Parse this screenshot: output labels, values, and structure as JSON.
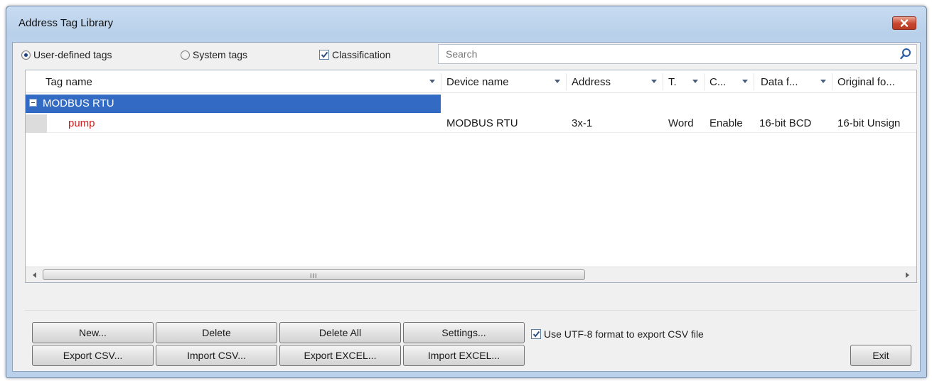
{
  "window": {
    "title": "Address Tag Library"
  },
  "options": {
    "user_defined_label": "User-defined tags",
    "system_tags_label": "System tags",
    "classification_label": "Classification",
    "user_defined_selected": true,
    "classification_checked": true
  },
  "search": {
    "placeholder": "Search"
  },
  "grid": {
    "columns": [
      "Tag name",
      "Device name",
      "Address",
      "T.",
      "C...",
      "Data f...",
      "Original fo..."
    ],
    "group": {
      "label": "MODBUS RTU",
      "rows": [
        {
          "tag_name": "pump",
          "device_name": "MODBUS RTU",
          "address": "3x-1",
          "type": "Word",
          "conversion": "Enable",
          "data_format": "16-bit BCD",
          "original_format": "16-bit Unsign"
        }
      ]
    },
    "scroll_grip": "III"
  },
  "buttons": {
    "new": "New...",
    "delete": "Delete",
    "delete_all": "Delete All",
    "settings": "Settings...",
    "export_csv": "Export CSV...",
    "import_csv": "Import CSV...",
    "export_excel": "Export EXCEL...",
    "import_excel": "Import EXCEL...",
    "exit": "Exit"
  },
  "utf8_option": {
    "label": "Use UTF-8 format to export CSV file",
    "checked": true
  },
  "colors": {
    "selection": "#336bc4",
    "tag_name_red": "#d11b1b",
    "close_button": "#c7462e",
    "frame": "#b9d1ea"
  }
}
